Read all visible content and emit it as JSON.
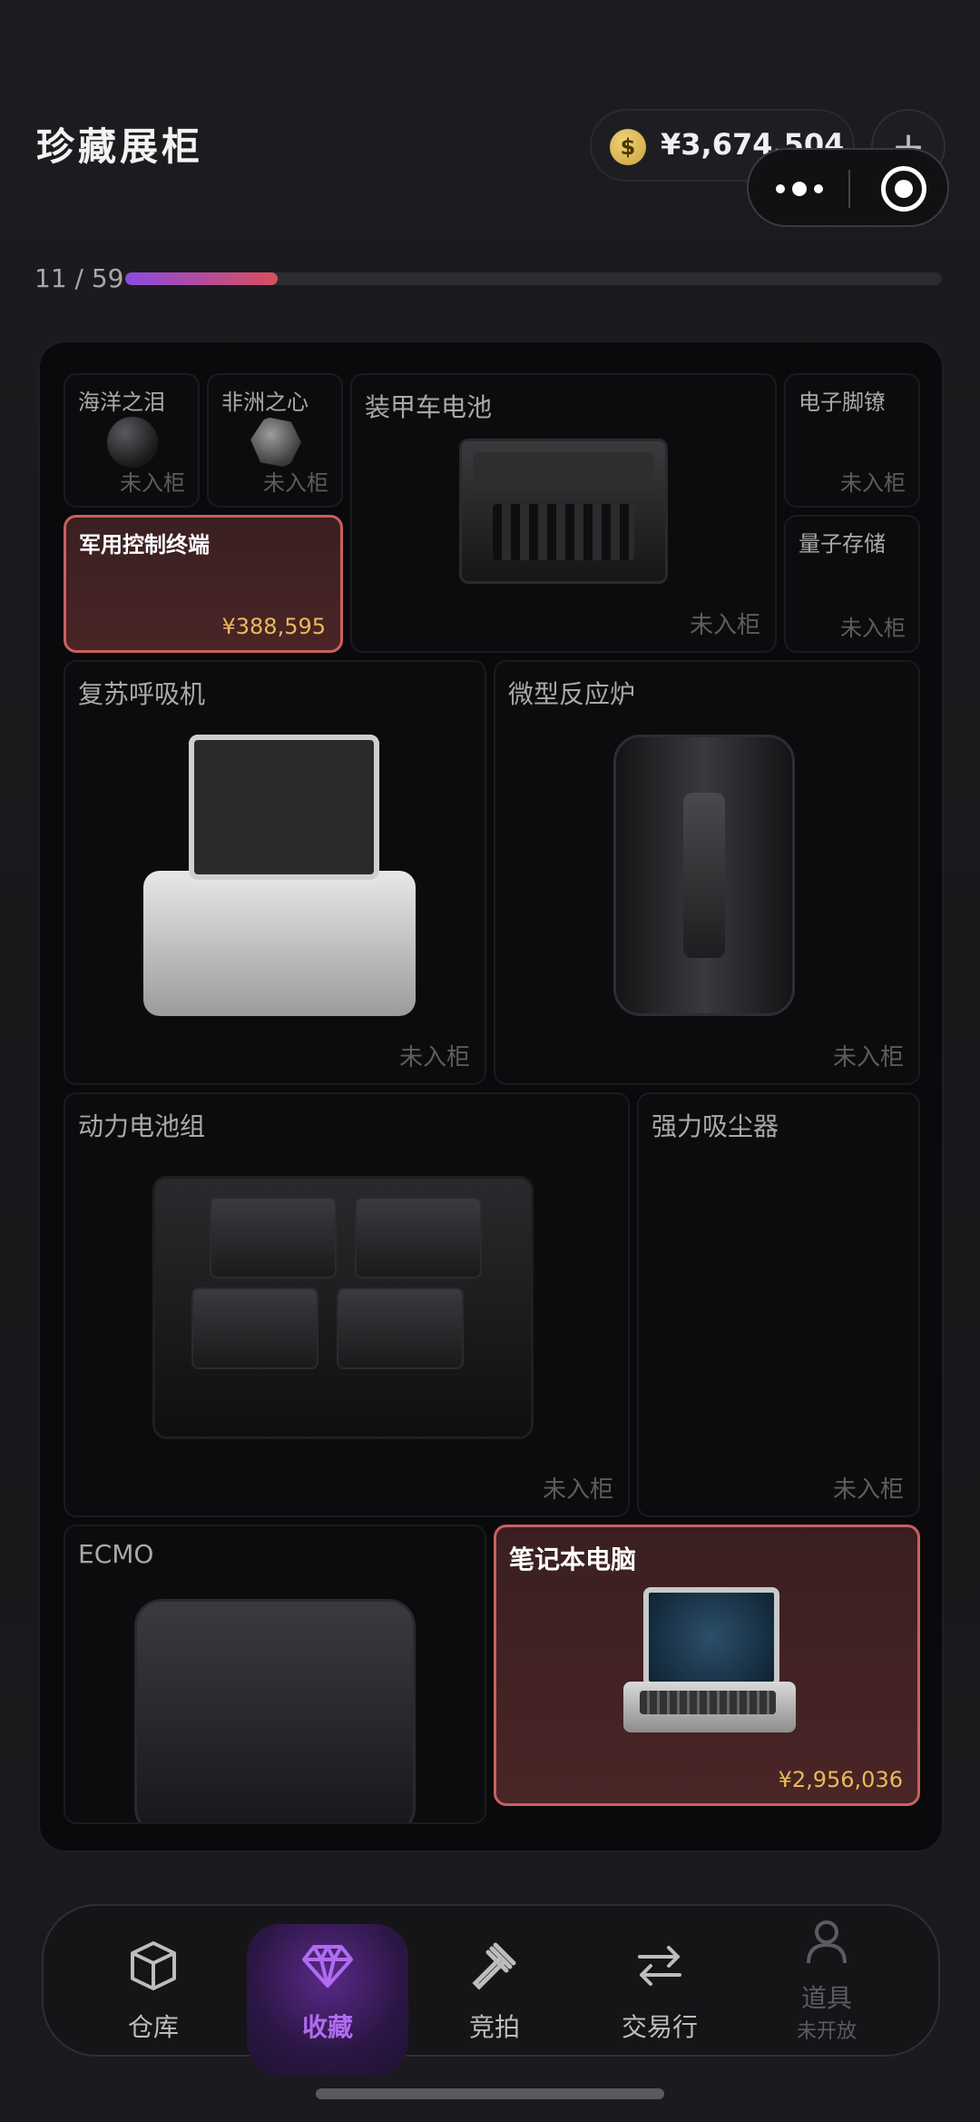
{
  "header": {
    "title": "珍藏展柜",
    "coin_symbol": "$",
    "coin_value": "¥3,674,504",
    "plus_label": "+"
  },
  "progress": {
    "text": "11 / 59",
    "fraction": 0.1864
  },
  "cabinet": {
    "status_not_in": "未入柜",
    "items": [
      {
        "name": "海洋之泪",
        "status": "未入柜"
      },
      {
        "name": "非洲之心",
        "status": "未入柜"
      },
      {
        "name": "装甲车电池",
        "status": "未入柜"
      },
      {
        "name": "电子脚镣",
        "status": "未入柜"
      },
      {
        "name": "军用控制终端",
        "price": "¥388,595"
      },
      {
        "name": "量子存储",
        "status": "未入柜"
      },
      {
        "name": "复苏呼吸机",
        "status": "未入柜"
      },
      {
        "name": "微型反应炉",
        "status": "未入柜"
      },
      {
        "name": "动力电池组",
        "status": "未入柜"
      },
      {
        "name": "强力吸尘器",
        "status": "未入柜"
      },
      {
        "name": "ECMO"
      },
      {
        "name": "笔记本电脑",
        "price": "¥2,956,036"
      }
    ]
  },
  "nav": {
    "items": [
      {
        "label": "仓库",
        "icon": "box-icon"
      },
      {
        "label": "收藏",
        "icon": "diamond-icon"
      },
      {
        "label": "竞拍",
        "icon": "gavel-icon"
      },
      {
        "label": "交易行",
        "icon": "swap-icon"
      },
      {
        "label": "道具",
        "sub": "未开放",
        "icon": "user-icon"
      }
    ],
    "active_index": 1
  },
  "colors": {
    "accent": "#b06cf0",
    "price": "#e9b95a",
    "owned_border": "#c9615f"
  }
}
